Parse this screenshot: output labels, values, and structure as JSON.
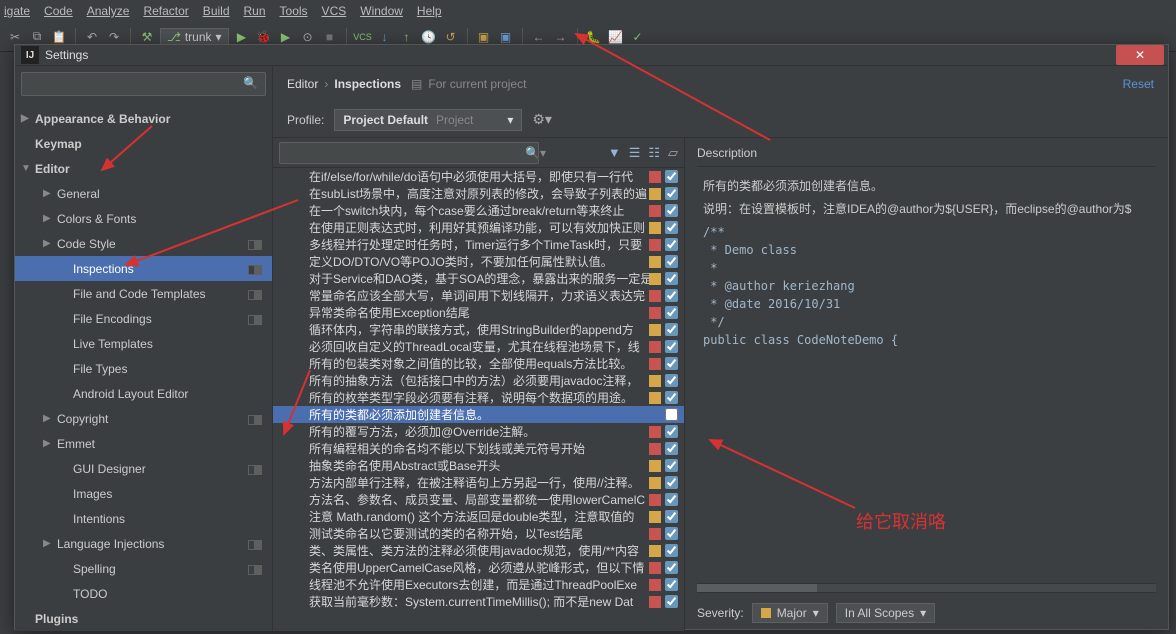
{
  "menubar": [
    "igate",
    "Code",
    "Analyze",
    "Refactor",
    "Build",
    "Run",
    "Tools",
    "VCS",
    "Window",
    "Help"
  ],
  "toolbar_combo": "trunk",
  "dialog": {
    "title": "Settings",
    "reset": "Reset"
  },
  "breadcrumb": {
    "a": "Editor",
    "b": "Inspections",
    "suffix": "For current project"
  },
  "profile": {
    "label": "Profile:",
    "value": "Project Default",
    "secondary": "Project"
  },
  "left_tree": [
    {
      "label": "Appearance & Behavior",
      "bold": true,
      "arrow": "▶"
    },
    {
      "label": "Keymap",
      "bold": true
    },
    {
      "label": "Editor",
      "bold": true,
      "arrow": "▼"
    },
    {
      "label": "General",
      "sub": true,
      "arrow": "▶"
    },
    {
      "label": "Colors & Fonts",
      "sub": true,
      "arrow": "▶"
    },
    {
      "label": "Code Style",
      "sub": true,
      "arrow": "▶",
      "badge": true
    },
    {
      "label": "Inspections",
      "sub2": true,
      "selected": true,
      "badge": true
    },
    {
      "label": "File and Code Templates",
      "sub2": true,
      "badge": true
    },
    {
      "label": "File Encodings",
      "sub2": true,
      "badge": true
    },
    {
      "label": "Live Templates",
      "sub2": true
    },
    {
      "label": "File Types",
      "sub2": true
    },
    {
      "label": "Android Layout Editor",
      "sub2": true
    },
    {
      "label": "Copyright",
      "sub": true,
      "arrow": "▶",
      "badge": true
    },
    {
      "label": "Emmet",
      "sub": true,
      "arrow": "▶"
    },
    {
      "label": "GUI Designer",
      "sub2": true,
      "badge": true
    },
    {
      "label": "Images",
      "sub2": true
    },
    {
      "label": "Intentions",
      "sub2": true
    },
    {
      "label": "Language Injections",
      "sub": true,
      "arrow": "▶",
      "badge": true
    },
    {
      "label": "Spelling",
      "sub2": true,
      "badge": true
    },
    {
      "label": "TODO",
      "sub2": true
    },
    {
      "label": "Plugins",
      "bold": true
    }
  ],
  "inspections": [
    {
      "t": "在if/else/for/while/do语句中必须使用大括号，即使只有一行代",
      "sev": "red",
      "c": true
    },
    {
      "t": "在subList场景中，高度注意对原列表的修改，会导致子列表的遍",
      "sev": "yellow",
      "c": true
    },
    {
      "t": "在一个switch块内，每个case要么通过break/return等来终止",
      "sev": "red",
      "c": true
    },
    {
      "t": "在使用正则表达式时，利用好其预编译功能，可以有效加快正则",
      "sev": "yellow",
      "c": true
    },
    {
      "t": "多线程并行处理定时任务时，Timer运行多个TimeTask时，只要",
      "sev": "red",
      "c": true
    },
    {
      "t": "定义DO/DTO/VO等POJO类时，不要加任何属性默认值。",
      "sev": "yellow",
      "c": true
    },
    {
      "t": "对于Service和DAO类，基于SOA的理念，暴露出来的服务一定是",
      "sev": "yellow",
      "c": true
    },
    {
      "t": "常量命名应该全部大写，单词间用下划线隔开，力求语义表达完",
      "sev": "red",
      "c": true
    },
    {
      "t": "异常类命名使用Exception结尾",
      "sev": "red",
      "c": true
    },
    {
      "t": "循环体内，字符串的联接方式，使用StringBuilder的append方",
      "sev": "yellow",
      "c": true
    },
    {
      "t": "必须回收自定义的ThreadLocal变量，尤其在线程池场景下，线",
      "sev": "red",
      "c": true
    },
    {
      "t": "所有的包装类对象之间值的比较，全部使用equals方法比较。",
      "sev": "red",
      "c": true
    },
    {
      "t": "所有的抽象方法（包括接口中的方法）必须要用javadoc注释，",
      "sev": "yellow",
      "c": true
    },
    {
      "t": "所有的枚举类型字段必须要有注释，说明每个数据项的用途。",
      "sev": "yellow",
      "c": true
    },
    {
      "t": "所有的类都必须添加创建者信息。",
      "sev": "",
      "c": false,
      "sel": true
    },
    {
      "t": "所有的覆写方法，必须加@Override注解。",
      "sev": "red",
      "c": true
    },
    {
      "t": "所有编程相关的命名均不能以下划线或美元符号开始",
      "sev": "red",
      "c": true
    },
    {
      "t": "抽象类命名使用Abstract或Base开头",
      "sev": "yellow",
      "c": true
    },
    {
      "t": "方法内部单行注释，在被注释语句上方另起一行，使用//注释。",
      "sev": "yellow",
      "c": true
    },
    {
      "t": "方法名、参数名、成员变量、局部变量都统一使用lowerCamelC",
      "sev": "red",
      "c": true
    },
    {
      "t": "注意 Math.random() 这个方法返回是double类型，注意取值的",
      "sev": "yellow",
      "c": true
    },
    {
      "t": "测试类命名以它要测试的类的名称开始，以Test结尾",
      "sev": "red",
      "c": true
    },
    {
      "t": "类、类属性、类方法的注释必须使用javadoc规范，使用/**内容",
      "sev": "yellow",
      "c": true
    },
    {
      "t": "类名使用UpperCamelCase风格，必须遵从驼峰形式，但以下情",
      "sev": "red",
      "c": true
    },
    {
      "t": "线程池不允许使用Executors去创建，而是通过ThreadPoolExe",
      "sev": "red",
      "c": true
    },
    {
      "t": "获取当前毫秒数：System.currentTimeMillis(); 而不是new Dat",
      "sev": "red",
      "c": true
    }
  ],
  "desc": {
    "label": "Description",
    "title": "所有的类都必须添加创建者信息。",
    "note": "说明：在设置模板时，注意IDEA的@author为${USER}，而eclipse的@author为$",
    "code": "/**\n * Demo class\n *\n * @author keriezhang\n * @date 2016/10/31\n */\npublic class CodeNoteDemo {"
  },
  "severity": {
    "label": "Severity:",
    "value": "Major",
    "scope": "In All Scopes"
  },
  "annotation": "给它取消咯"
}
